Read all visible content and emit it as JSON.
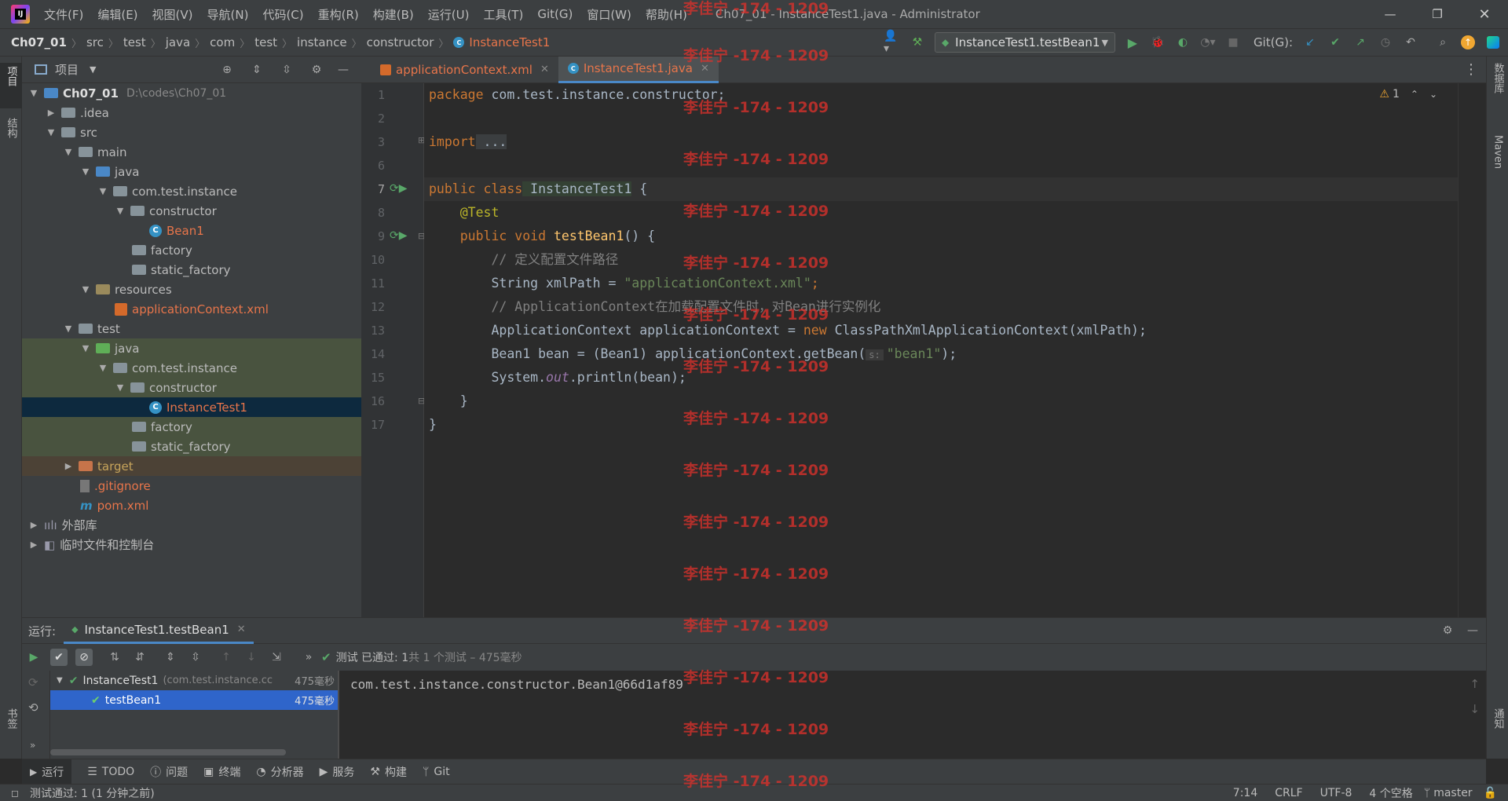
{
  "window": {
    "title": "Ch07_01 - InstanceTest1.java - Administrator",
    "menu": [
      "文件(F)",
      "编辑(E)",
      "视图(V)",
      "导航(N)",
      "代码(C)",
      "重构(R)",
      "构建(B)",
      "运行(U)",
      "工具(T)",
      "Git(G)",
      "窗口(W)",
      "帮助(H)"
    ]
  },
  "breadcrumb": [
    "Ch07_01",
    "src",
    "test",
    "java",
    "com",
    "test",
    "instance",
    "constructor",
    "InstanceTest1"
  ],
  "run_config": "InstanceTest1.testBean1",
  "git_label": "Git(G):",
  "left_strip": {
    "project": "项目",
    "structure": "结构",
    "bookmarks": "书签"
  },
  "right_strip": {
    "database": "数据库",
    "maven": "Maven",
    "notifications": "通知"
  },
  "project_panel": {
    "title": "项目",
    "tree": [
      {
        "label": "Ch07_01",
        "extra": "D:\\codes\\Ch07_01"
      },
      {
        "label": ".idea"
      },
      {
        "label": "src"
      },
      {
        "label": "main"
      },
      {
        "label": "java"
      },
      {
        "label": "com.test.instance"
      },
      {
        "label": "constructor"
      },
      {
        "label": "Bean1"
      },
      {
        "label": "factory"
      },
      {
        "label": "static_factory"
      },
      {
        "label": "resources"
      },
      {
        "label": "applicationContext.xml"
      },
      {
        "label": "test"
      },
      {
        "label": "java"
      },
      {
        "label": "com.test.instance"
      },
      {
        "label": "constructor"
      },
      {
        "label": "InstanceTest1"
      },
      {
        "label": "factory"
      },
      {
        "label": "static_factory"
      },
      {
        "label": "target"
      },
      {
        "label": ".gitignore"
      },
      {
        "label": "pom.xml"
      },
      {
        "label": "外部库"
      },
      {
        "label": "临时文件和控制台"
      }
    ]
  },
  "editor": {
    "tabs": [
      {
        "label": "applicationContext.xml",
        "active": false
      },
      {
        "label": "InstanceTest1.java",
        "active": true
      }
    ],
    "warning_count": "1",
    "line_numbers": [
      "1",
      "2",
      "3",
      "6",
      "7",
      "8",
      "9",
      "10",
      "11",
      "12",
      "13",
      "14",
      "15",
      "16",
      "17"
    ],
    "code": {
      "l1_kw": "package",
      "l1_rest": " com.test.instance.constructor;",
      "l3_kw": "import",
      "l3_rest": " ...",
      "l7_kw": "public class",
      "l7_name": " InstanceTest1",
      "l7_rest": " {",
      "l8_an": "    @Test",
      "l9_kw": "    public void",
      "l9_fn": " testBean1",
      "l9_rest": "() {",
      "l10_cm": "        // 定义配置文件路径",
      "l11_a": "        String xmlPath = ",
      "l11_str": "\"applicationContext.xml\"",
      "l11_b": ";",
      "l12_cm": "        // ApplicationContext在加载配置文件时，对Bean进行实例化",
      "l13_a": "        ApplicationContext applicationContext = ",
      "l13_kw": "new",
      "l13_b": " ClassPathXmlApplicationContext(xmlPath);",
      "l14_a": "        Bean1 bean = (Bean1) applicationContext.getBean(",
      "l14_hint": "s:",
      "l14_str": "\"bean1\"",
      "l14_b": ");",
      "l15_a": "        System.",
      "l15_st": "out",
      "l15_b": ".println(bean);",
      "l16": "    }",
      "l17": "}"
    }
  },
  "watermark": "李佳宁 -174 - 1209",
  "run_panel": {
    "label": "运行:",
    "tab": "InstanceTest1.testBean1",
    "status_prefix": "测试 已通过: ",
    "status_count": "1",
    "status_rest": "共 1 个测试 – 475毫秒",
    "tree": [
      {
        "name": "InstanceTest1",
        "extra": "(com.test.instance.cc",
        "time": "475毫秒"
      },
      {
        "name": "testBean1",
        "time": "475毫秒"
      }
    ],
    "console_output": "com.test.instance.constructor.Bean1@66d1af89"
  },
  "bottom_tools": [
    "运行",
    "TODO",
    "问题",
    "终端",
    "分析器",
    "服务",
    "构建",
    "Git"
  ],
  "status": {
    "message": "测试通过: 1 (1 分钟之前)",
    "position": "7:14",
    "line_sep": "CRLF",
    "encoding": "UTF-8",
    "indent": "4 个空格",
    "branch": "master"
  }
}
